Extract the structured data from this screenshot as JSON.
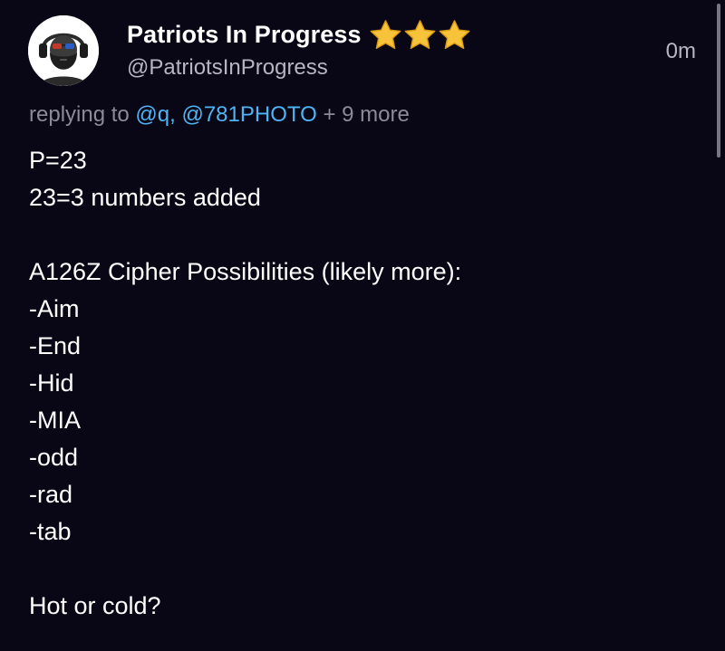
{
  "author": {
    "display_name": "Patriots In Progress",
    "handle": "@PatriotsInProgress",
    "badge_icons": [
      "star-icon",
      "star-icon",
      "star-icon"
    ],
    "avatar_icon": "bearded-man-headphones-avatar"
  },
  "timestamp": "0m",
  "reply": {
    "prefix": "replying to",
    "mentions": [
      "@q,",
      "@781PHOTO"
    ],
    "more": "+ 9 more"
  },
  "body_lines": [
    "P=23",
    "23=3 numbers added",
    "",
    "A126Z Cipher Possibilities (likely more):",
    "-Aim",
    "-End",
    "-Hid",
    "-MIA",
    "-odd",
    "-rad",
    "-tab",
    "",
    "Hot or cold?"
  ],
  "colors": {
    "background": "#090716",
    "mention": "#4fb4f4",
    "star": "#f6c33a",
    "muted_text": "#b7b5c2"
  }
}
